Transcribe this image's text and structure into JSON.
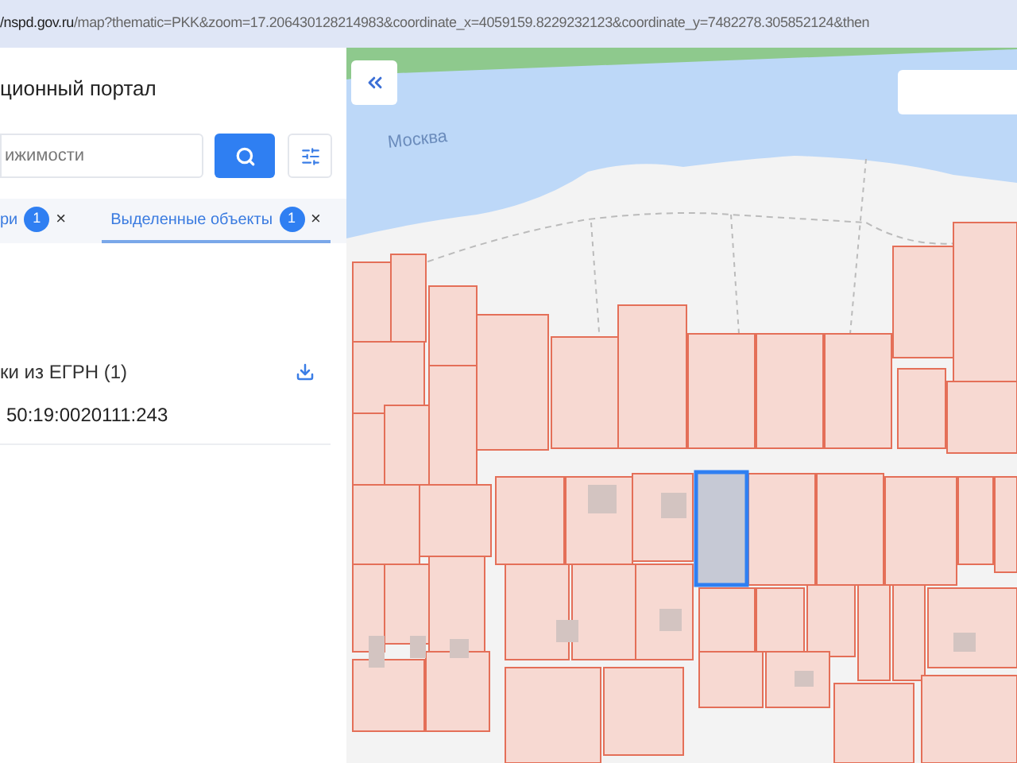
{
  "address_bar": {
    "host": "/nspd.gov.ru",
    "path": "/map?thematic=PKK&zoom=17.206430128214983&coordinate_x=4059159.8229232123&coordinate_y=7482278.305852124&then"
  },
  "panel": {
    "title": "ционный портал",
    "search": {
      "placeholder": "ижимости"
    },
    "tabs": [
      {
        "label": "ри",
        "count": "1",
        "close": "×",
        "selected": false
      },
      {
        "label": "Выделенные объекты",
        "count": "1",
        "close": "×",
        "selected": true
      }
    ],
    "section": {
      "title": "ки из ЕГРН (1)",
      "items": [
        "50:19:0020111:243"
      ]
    }
  },
  "map": {
    "river_label": "Москва"
  }
}
